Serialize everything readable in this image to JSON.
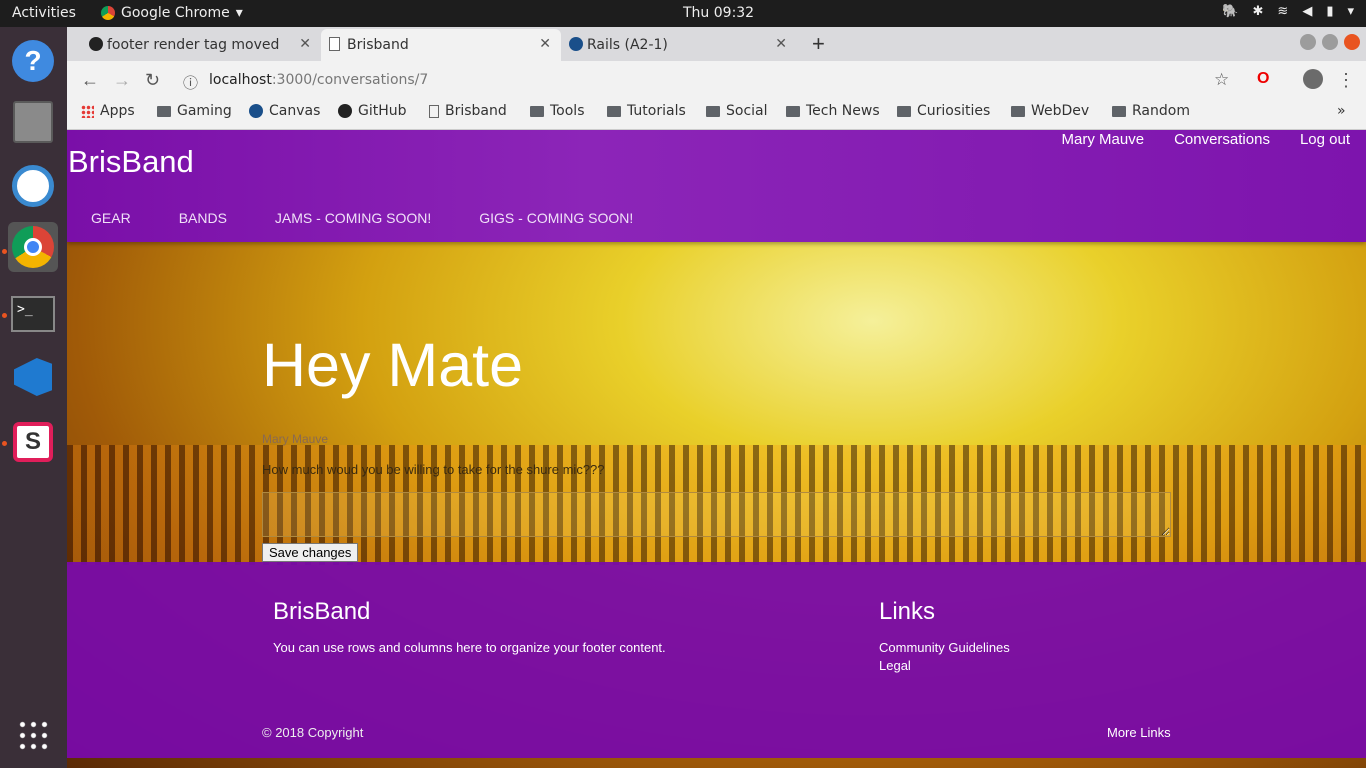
{
  "system": {
    "activities": "Activities",
    "app_name": "Google Chrome",
    "clock": "Thu 09:32"
  },
  "browser": {
    "tabs": [
      {
        "label": "footer render tag moved"
      },
      {
        "label": "Brisband"
      },
      {
        "label": "Rails (A2-1)"
      }
    ],
    "url_host": "localhost",
    "url_path": ":3000/conversations/7",
    "bookmarks": [
      {
        "label": "Apps"
      },
      {
        "label": "Gaming"
      },
      {
        "label": "Canvas"
      },
      {
        "label": "GitHub"
      },
      {
        "label": "Brisband"
      },
      {
        "label": "Tools"
      },
      {
        "label": "Tutorials"
      },
      {
        "label": "Social"
      },
      {
        "label": "Tech News"
      },
      {
        "label": "Curiosities"
      },
      {
        "label": "WebDev"
      },
      {
        "label": "Random"
      }
    ]
  },
  "site": {
    "brand": "BrisBand",
    "user_nav": [
      "Mary Mauve",
      "Conversations",
      "Log out"
    ],
    "menu": [
      "GEAR",
      "BANDS",
      "JAMS - COMING SOON!",
      "GIGS - COMING SOON!"
    ]
  },
  "conversation": {
    "title": "Hey Mate",
    "sender": "Mary Mauve",
    "message": "How much woud you be willing to take for the shure mic???",
    "save_label": "Save changes"
  },
  "footer": {
    "brand": "BrisBand",
    "description": "You can use rows and columns here to organize your footer content.",
    "links_title": "Links",
    "links": [
      "Community Guidelines",
      "Legal"
    ],
    "copyright": "© 2018 Copyright",
    "more_links": "More Links"
  },
  "colors": {
    "header": "#8c25b8",
    "footer": "#7a0aaa",
    "accent": "#e95420"
  }
}
